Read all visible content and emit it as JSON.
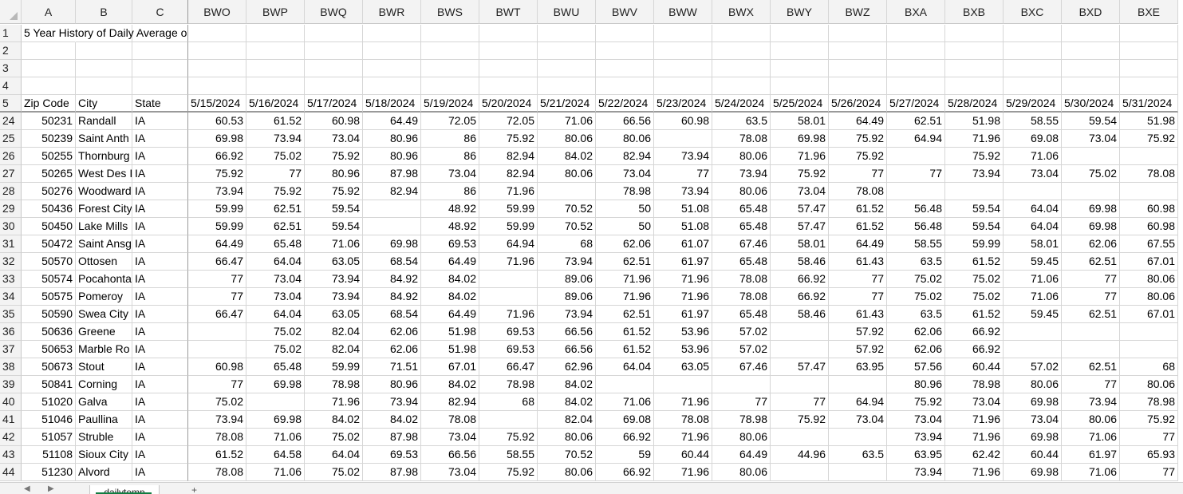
{
  "sheet": {
    "tab_name": "dailytemp",
    "add_sheet_icon": "plus-icon"
  },
  "column_letters": [
    "A",
    "B",
    "C",
    "BWO",
    "BWP",
    "BWQ",
    "BWR",
    "BWS",
    "BWT",
    "BWU",
    "BWV",
    "BWW",
    "BWX",
    "BWY",
    "BWZ",
    "BXA",
    "BXB",
    "BXC",
    "BXD",
    "BXE"
  ],
  "top_rows": [
    {
      "row": "1",
      "cells": [
        "5 Year History of Daily Average o",
        "",
        "",
        "",
        "",
        "",
        "",
        "",
        "",
        "",
        "",
        "",
        "",
        "",
        "",
        "",
        "",
        "",
        "",
        ""
      ]
    },
    {
      "row": "2",
      "cells": [
        "",
        "",
        "",
        "",
        "",
        "",
        "",
        "",
        "",
        "",
        "",
        "",
        "",
        "",
        "",
        "",
        "",
        "",
        "",
        ""
      ]
    },
    {
      "row": "3",
      "cells": [
        "",
        "",
        "",
        "",
        "",
        "",
        "",
        "",
        "",
        "",
        "",
        "",
        "",
        "",
        "",
        "",
        "",
        "",
        "",
        ""
      ]
    },
    {
      "row": "4",
      "cells": [
        "",
        "",
        "",
        "",
        "",
        "",
        "",
        "",
        "",
        "",
        "",
        "",
        "",
        "",
        "",
        "",
        "",
        "",
        "",
        ""
      ]
    },
    {
      "row": "5",
      "cells": [
        "Zip Code",
        "City",
        "State",
        "5/15/2024",
        "5/16/2024",
        "5/17/2024",
        "5/18/2024",
        "5/19/2024",
        "5/20/2024",
        "5/21/2024",
        "5/22/2024",
        "5/23/2024",
        "5/24/2024",
        "5/25/2024",
        "5/26/2024",
        "5/27/2024",
        "5/28/2024",
        "5/29/2024",
        "5/30/2024",
        "5/31/2024"
      ]
    }
  ],
  "data_rows": [
    {
      "row": "24",
      "cells": [
        "50231",
        "Randall",
        "IA",
        "60.53",
        "61.52",
        "60.98",
        "64.49",
        "72.05",
        "72.05",
        "71.06",
        "66.56",
        "60.98",
        "63.5",
        "58.01",
        "64.49",
        "62.51",
        "51.98",
        "58.55",
        "59.54",
        "51.98"
      ]
    },
    {
      "row": "25",
      "cells": [
        "50239",
        "Saint Anth",
        "IA",
        "69.98",
        "73.94",
        "73.04",
        "80.96",
        "86",
        "75.92",
        "80.06",
        "80.06",
        "",
        "78.08",
        "69.98",
        "75.92",
        "64.94",
        "71.96",
        "69.08",
        "73.04",
        "75.92"
      ]
    },
    {
      "row": "26",
      "cells": [
        "50255",
        "Thornburg",
        "IA",
        "66.92",
        "75.02",
        "75.92",
        "80.96",
        "86",
        "82.94",
        "84.02",
        "82.94",
        "73.94",
        "80.06",
        "71.96",
        "75.92",
        "",
        "75.92",
        "71.06",
        "",
        ""
      ]
    },
    {
      "row": "27",
      "cells": [
        "50265",
        "West Des I",
        "IA",
        "75.92",
        "77",
        "80.96",
        "87.98",
        "73.04",
        "82.94",
        "80.06",
        "73.04",
        "77",
        "73.94",
        "75.92",
        "77",
        "77",
        "73.94",
        "73.04",
        "75.02",
        "78.08"
      ]
    },
    {
      "row": "28",
      "cells": [
        "50276",
        "Woodward",
        "IA",
        "73.94",
        "75.92",
        "75.92",
        "82.94",
        "86",
        "71.96",
        "",
        "78.98",
        "73.94",
        "80.06",
        "73.04",
        "78.08",
        "",
        "",
        "",
        "",
        ""
      ]
    },
    {
      "row": "29",
      "cells": [
        "50436",
        "Forest City",
        "IA",
        "59.99",
        "62.51",
        "59.54",
        "",
        "48.92",
        "59.99",
        "70.52",
        "50",
        "51.08",
        "65.48",
        "57.47",
        "61.52",
        "56.48",
        "59.54",
        "64.04",
        "69.98",
        "60.98"
      ]
    },
    {
      "row": "30",
      "cells": [
        "50450",
        "Lake Mills",
        "IA",
        "59.99",
        "62.51",
        "59.54",
        "",
        "48.92",
        "59.99",
        "70.52",
        "50",
        "51.08",
        "65.48",
        "57.47",
        "61.52",
        "56.48",
        "59.54",
        "64.04",
        "69.98",
        "60.98"
      ]
    },
    {
      "row": "31",
      "cells": [
        "50472",
        "Saint Ansg",
        "IA",
        "64.49",
        "65.48",
        "71.06",
        "69.98",
        "69.53",
        "64.94",
        "68",
        "62.06",
        "61.07",
        "67.46",
        "58.01",
        "64.49",
        "58.55",
        "59.99",
        "58.01",
        "62.06",
        "67.55"
      ]
    },
    {
      "row": "32",
      "cells": [
        "50570",
        "Ottosen",
        "IA",
        "66.47",
        "64.04",
        "63.05",
        "68.54",
        "64.49",
        "71.96",
        "73.94",
        "62.51",
        "61.97",
        "65.48",
        "58.46",
        "61.43",
        "63.5",
        "61.52",
        "59.45",
        "62.51",
        "67.01"
      ]
    },
    {
      "row": "33",
      "cells": [
        "50574",
        "Pocahonta",
        "IA",
        "77",
        "73.04",
        "73.94",
        "84.92",
        "84.02",
        "",
        "89.06",
        "71.96",
        "71.96",
        "78.08",
        "66.92",
        "77",
        "75.02",
        "75.02",
        "71.06",
        "77",
        "80.06"
      ]
    },
    {
      "row": "34",
      "cells": [
        "50575",
        "Pomeroy",
        "IA",
        "77",
        "73.04",
        "73.94",
        "84.92",
        "84.02",
        "",
        "89.06",
        "71.96",
        "71.96",
        "78.08",
        "66.92",
        "77",
        "75.02",
        "75.02",
        "71.06",
        "77",
        "80.06"
      ]
    },
    {
      "row": "35",
      "cells": [
        "50590",
        "Swea City",
        "IA",
        "66.47",
        "64.04",
        "63.05",
        "68.54",
        "64.49",
        "71.96",
        "73.94",
        "62.51",
        "61.97",
        "65.48",
        "58.46",
        "61.43",
        "63.5",
        "61.52",
        "59.45",
        "62.51",
        "67.01"
      ]
    },
    {
      "row": "36",
      "cells": [
        "50636",
        "Greene",
        "IA",
        "",
        "75.02",
        "82.04",
        "62.06",
        "51.98",
        "69.53",
        "66.56",
        "61.52",
        "53.96",
        "57.02",
        "",
        "57.92",
        "62.06",
        "66.92",
        "",
        "",
        ""
      ]
    },
    {
      "row": "37",
      "cells": [
        "50653",
        "Marble Ro",
        "IA",
        "",
        "75.02",
        "82.04",
        "62.06",
        "51.98",
        "69.53",
        "66.56",
        "61.52",
        "53.96",
        "57.02",
        "",
        "57.92",
        "62.06",
        "66.92",
        "",
        "",
        ""
      ]
    },
    {
      "row": "38",
      "cells": [
        "50673",
        "Stout",
        "IA",
        "60.98",
        "65.48",
        "59.99",
        "71.51",
        "67.01",
        "66.47",
        "62.96",
        "64.04",
        "63.05",
        "67.46",
        "57.47",
        "63.95",
        "57.56",
        "60.44",
        "57.02",
        "62.51",
        "68"
      ]
    },
    {
      "row": "39",
      "cells": [
        "50841",
        "Corning",
        "IA",
        "77",
        "69.98",
        "78.98",
        "80.96",
        "84.02",
        "78.98",
        "84.02",
        "",
        "",
        "",
        "",
        "",
        "80.96",
        "78.98",
        "80.06",
        "77",
        "80.06"
      ]
    },
    {
      "row": "40",
      "cells": [
        "51020",
        "Galva",
        "IA",
        "75.02",
        "",
        "71.96",
        "73.94",
        "82.94",
        "68",
        "84.02",
        "71.06",
        "71.96",
        "77",
        "77",
        "64.94",
        "75.92",
        "73.04",
        "69.98",
        "73.94",
        "78.98"
      ]
    },
    {
      "row": "41",
      "cells": [
        "51046",
        "Paullina",
        "IA",
        "73.94",
        "69.98",
        "84.02",
        "84.02",
        "78.08",
        "",
        "82.04",
        "69.08",
        "78.08",
        "78.98",
        "75.92",
        "73.04",
        "73.04",
        "71.96",
        "73.04",
        "80.06",
        "75.92"
      ]
    },
    {
      "row": "42",
      "cells": [
        "51057",
        "Struble",
        "IA",
        "78.08",
        "71.06",
        "75.02",
        "87.98",
        "73.04",
        "75.92",
        "80.06",
        "66.92",
        "71.96",
        "80.06",
        "",
        "",
        "73.94",
        "71.96",
        "69.98",
        "71.06",
        "77"
      ]
    },
    {
      "row": "43",
      "cells": [
        "51108",
        "Sioux City",
        "IA",
        "61.52",
        "64.58",
        "64.04",
        "69.53",
        "66.56",
        "58.55",
        "70.52",
        "59",
        "60.44",
        "64.49",
        "44.96",
        "63.5",
        "63.95",
        "62.42",
        "60.44",
        "61.97",
        "65.93"
      ]
    },
    {
      "row": "44",
      "cells": [
        "51230",
        "Alvord",
        "IA",
        "78.08",
        "71.06",
        "75.02",
        "87.98",
        "73.04",
        "75.92",
        "80.06",
        "66.92",
        "71.96",
        "80.06",
        "",
        "",
        "73.94",
        "71.96",
        "69.98",
        "71.06",
        "77"
      ]
    }
  ]
}
